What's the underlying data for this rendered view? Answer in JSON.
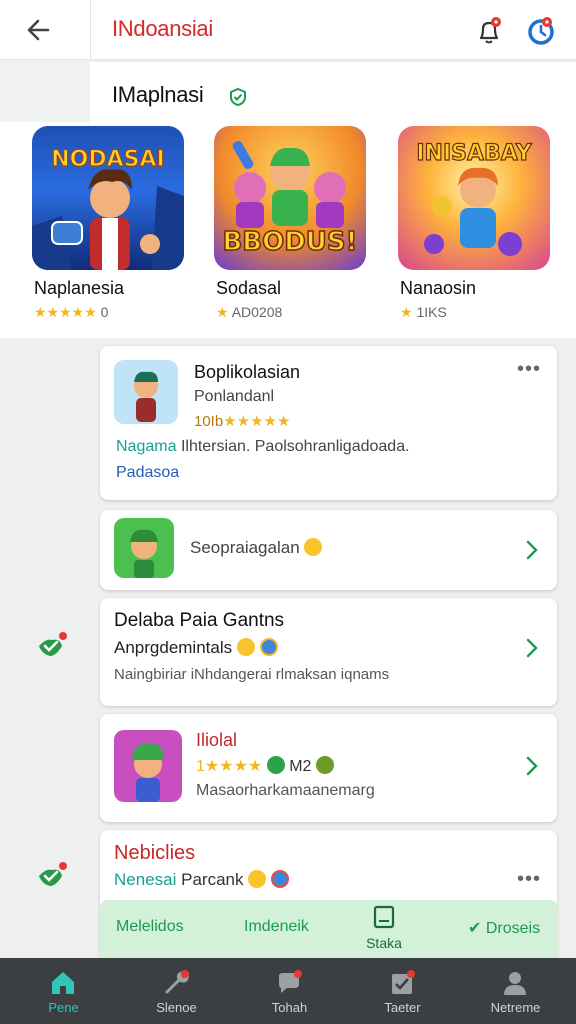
{
  "header": {
    "title": "INdoansiai"
  },
  "featured": {
    "title": "IMaplnasi",
    "cards": [
      {
        "name": "Naplanesia",
        "stars": "★★★★★",
        "rating": "0",
        "art": "NODASAI"
      },
      {
        "name": "Sodasal",
        "stars": "★",
        "rating": "AD0208",
        "art": "BBODUS!"
      },
      {
        "name": "Nanaosin",
        "stars": "★",
        "rating": "1IKS",
        "art": "INISABAY"
      }
    ]
  },
  "card1": {
    "title": "Boplikolasian",
    "subtitle": "Ponlandanl",
    "rating_num": "10Ib",
    "stars": "★★★★★",
    "tag1": "Nagama",
    "desc": "Ilhtersian. Paolsohranligadoada.",
    "tag2": "Padasoa"
  },
  "card2": {
    "label": "Seopraiagalan"
  },
  "card3": {
    "title": "Delaba Paia Gantns",
    "line1": "Anprgdemintals",
    "line2": "Naingbiriar iNhdangerai rlmaksan iqnams"
  },
  "card4": {
    "title": "Iliolal",
    "stars": "1★★★★",
    "extra": "M2",
    "desc": "Masaorharkamaanemarg"
  },
  "card5": {
    "title": "Nebiclies",
    "line1a": "Nenesai",
    "line1b": "Parcank"
  },
  "action_strip": {
    "a": "Melelidos",
    "b": "Imdeneik",
    "c": "Staka",
    "d": "Droseis"
  },
  "tabs": [
    {
      "label": "Pene"
    },
    {
      "label": "Slenoe"
    },
    {
      "label": "Tohah"
    },
    {
      "label": "Taeter"
    },
    {
      "label": "Netreme"
    }
  ],
  "colors": {
    "accent_red": "#d82727",
    "accent_green": "#1c9a54",
    "teal": "#2fc6b8",
    "tabbar": "#3b3f42"
  }
}
